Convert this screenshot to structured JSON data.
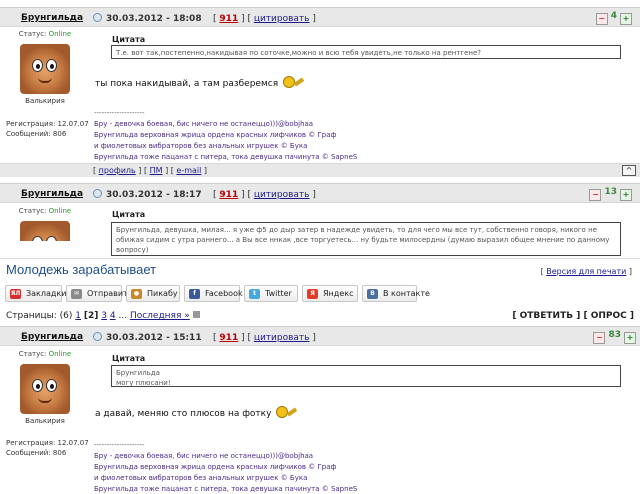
{
  "post1": {
    "author": "Брунгильда",
    "datetime": "30.03.2012 - 18:08",
    "post_number": "911",
    "quote_link": "цитировать",
    "rating": "4",
    "status_label": "Статус:",
    "status_value": "Online",
    "rank": "Валькирия",
    "registered": "Регистрация: 12.07.07",
    "messages": "Сообщений: 806",
    "quote_title": "Цитата",
    "quote_text": "Т.е. вот так,постепенно,накидывая по соточке,можно и всю тебя увидеть,не только на рентгене?",
    "body": "ты пока накидывай, а там разберемся",
    "sig_sep": "--------------------",
    "sig_lines": [
      "Бру - девочка боевая, бис ничего не останеццо)))@bobjhaa",
      "Брунгильда верховная жрица ордена красных лифчиков © Граф",
      "и фиолетовых вибраторов без анальных игрушек © Бука",
      "Брунгильда тоже пацанат с питера, тока девушка пачинута © SapneS"
    ],
    "foot_profile": "профиль",
    "foot_pm": "ПМ",
    "foot_email": "e-mail",
    "up": "^"
  },
  "post2": {
    "author": "Брунгильда",
    "datetime": "30.03.2012 - 18:17",
    "post_number": "911",
    "quote_link": "цитировать",
    "rating": "13",
    "status_label": "Статус:",
    "status_value": "Online",
    "quote_title": "Цитата",
    "quote_text": "Брунгильда, девушка, милая... я уже ф5 до дыр затер в надежде увидеть, то для чего мы все тут, собственно говоря, никого не обижая сидим с утра раннего... а Вы все ннкак ,все торгуетесь... ну будьте милосердны (думаю выразил общее мнение по данному вопросу)"
  },
  "topic": {
    "title": "Молодежь зарабатывает",
    "print_link": "Версия для печати"
  },
  "share": [
    {
      "label": "Закладки",
      "icon": "yandex-bookmarks-icon",
      "color": "#d32f2f",
      "glyph": "ЯЛ"
    },
    {
      "label": "Отправить",
      "icon": "mail-icon",
      "color": "#8a8a8a",
      "glyph": "✉"
    },
    {
      "label": "Пикабу",
      "icon": "pikabu-icon",
      "color": "#c78a2a",
      "glyph": "●"
    },
    {
      "label": "Facebook",
      "icon": "facebook-icon",
      "color": "#3b5998",
      "glyph": "f"
    },
    {
      "label": "Twitter",
      "icon": "twitter-icon",
      "color": "#4aa8e0",
      "glyph": "t"
    },
    {
      "label": "Яндекс",
      "icon": "yandex-icon",
      "color": "#e63a2a",
      "glyph": "Я"
    },
    {
      "label": "В контакте",
      "icon": "vkontakte-icon",
      "color": "#4a6ea0",
      "glyph": "В"
    }
  ],
  "pager": {
    "label": "Страницы:",
    "count": "(6)",
    "page1": "1",
    "current": "[2]",
    "page3": "3",
    "page4": "4",
    "dots": "...",
    "last": "Последняя »"
  },
  "actions": {
    "reply": "ОТВЕТИТЬ",
    "poll": "ОПРОС"
  },
  "post3": {
    "author": "Брунгильда",
    "datetime": "30.03.2012 - 15:11",
    "post_number": "911",
    "quote_link": "цитировать",
    "rating": "83",
    "status_label": "Статус:",
    "status_value": "Online",
    "rank": "Валькирия",
    "registered": "Регистрация: 12.07.07",
    "messages": "Сообщений: 806",
    "quote_title": "Цитата",
    "quote_line1": "Брунгильда",
    "quote_line2": "могу плюсани!",
    "body": "а давай, меняю сто плюсов на фотку",
    "sig_sep": "--------------------",
    "sig_lines": [
      "Бру - девочка боевая, бис ничего не останеццо)))@bobjhaa",
      "Брунгильда верховная жрица ордена красных лифчиков © Граф",
      "и фиолетовых вибраторов без анальных игрушек © Бука",
      "Брунгильда тоже пацанат с питера, тока девушка пачинута © SapneS"
    ]
  }
}
